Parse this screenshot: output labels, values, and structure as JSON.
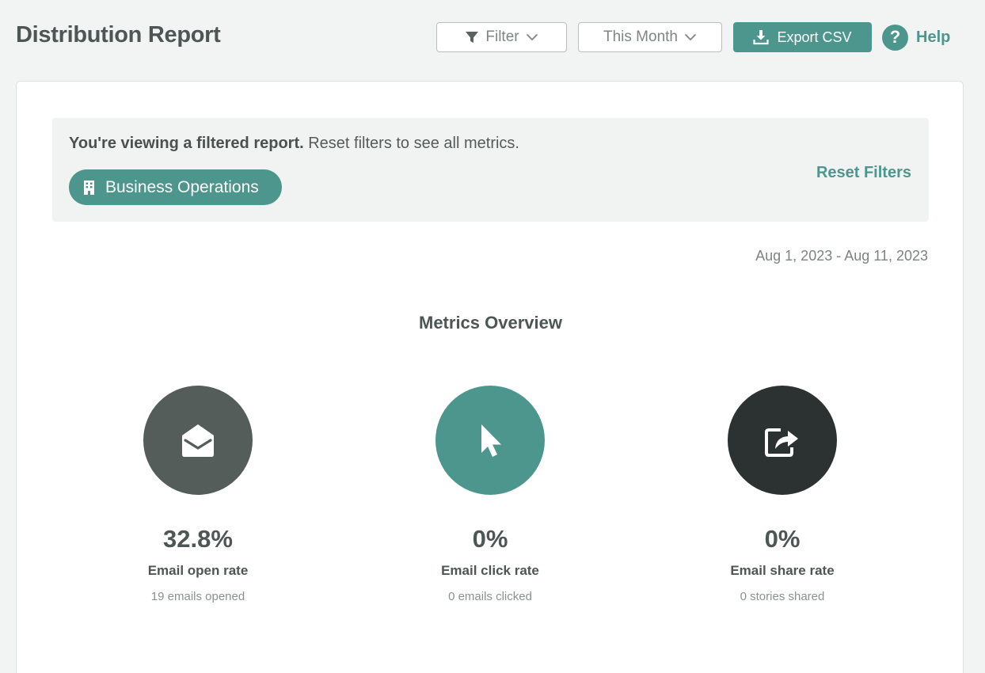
{
  "header": {
    "title": "Distribution Report",
    "filter_label": "Filter",
    "period_label": "This Month",
    "export_label": "Export CSV",
    "help_label": "Help",
    "help_glyph": "?"
  },
  "notice": {
    "bold_text": "You're viewing a filtered report.",
    "text": "Reset filters to see all metrics.",
    "chip_label": "Business Operations",
    "chip_icon": "building-icon",
    "reset_label": "Reset Filters"
  },
  "date_range": "Aug 1, 2023 - Aug 11, 2023",
  "overview": {
    "title": "Metrics Overview",
    "metrics": [
      {
        "value": "32.8%",
        "label": "Email open rate",
        "sub": "19 emails opened",
        "icon": "envelope-open-icon",
        "color": "#555d5b"
      },
      {
        "value": "0%",
        "label": "Email click rate",
        "sub": "0 emails clicked",
        "icon": "cursor-icon",
        "color": "#4d968d"
      },
      {
        "value": "0%",
        "label": "Email share rate",
        "sub": "0 stories shared",
        "icon": "share-icon",
        "color": "#2b3231"
      }
    ]
  },
  "colors": {
    "accent": "#4d968d",
    "page_bg": "#f2f4f3",
    "text": "#4d5654"
  }
}
